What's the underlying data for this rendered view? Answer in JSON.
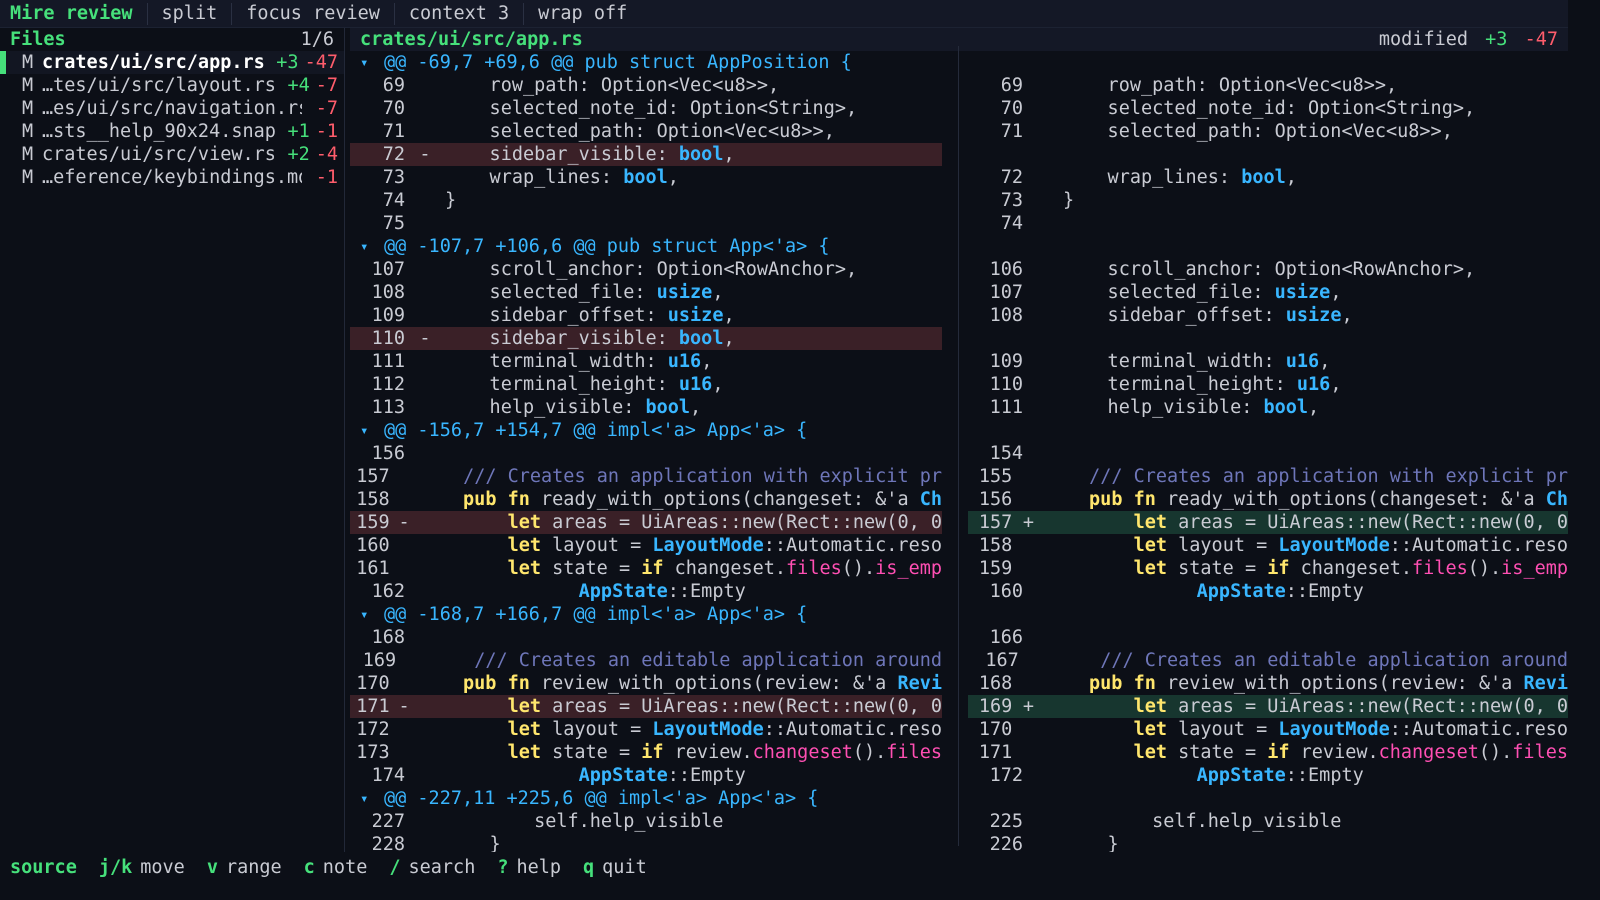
{
  "topbar": {
    "title": "Mire review",
    "tabs": [
      "split",
      "focus review",
      "context 3",
      "wrap off"
    ]
  },
  "sidebar": {
    "header": "Files",
    "count": "1/6",
    "files": [
      {
        "status": "M",
        "name": "crates/ui/src/app.rs",
        "add": "+3",
        "del": "-47",
        "selected": true
      },
      {
        "status": "M",
        "name": "…tes/ui/src/layout.rs",
        "add": "+4",
        "del": "-7"
      },
      {
        "status": "M",
        "name": "…es/ui/src/navigation.rs",
        "add": "",
        "del": "-7"
      },
      {
        "status": "M",
        "name": "…sts__help_90x24.snap",
        "add": "+1",
        "del": "-1"
      },
      {
        "status": "M",
        "name": "crates/ui/src/view.rs",
        "add": "+2",
        "del": "-4"
      },
      {
        "status": "M",
        "name": "…eference/keybindings.md",
        "add": "",
        "del": "-1"
      }
    ]
  },
  "diff": {
    "path": "crates/ui/src/app.rs",
    "status": "modified",
    "add": "+3",
    "del": "-47",
    "hunks": [
      {
        "header": "@@ -69,7 +69,6 @@ pub struct AppPosition {",
        "rows": [
          {
            "l": {
              "n": "69",
              "code": "    row_path: Option<Vec<u8>>,"
            },
            "r": {
              "n": "69",
              "code": "    row_path: Option<Vec<u8>>,"
            }
          },
          {
            "l": {
              "n": "70",
              "code": "    selected_note_id: Option<String>,"
            },
            "r": {
              "n": "70",
              "code": "    selected_note_id: Option<String>,"
            }
          },
          {
            "l": {
              "n": "71",
              "code": "    selected_path: Option<Vec<u8>>,"
            },
            "r": {
              "n": "71",
              "code": "    selected_path: Option<Vec<u8>>,"
            }
          },
          {
            "l": {
              "n": "72",
              "m": "-",
              "kind": "del",
              "code": "    sidebar_visible: bool,"
            },
            "r": {
              "n": "",
              "code": ""
            }
          },
          {
            "l": {
              "n": "73",
              "code": "    wrap_lines: bool,"
            },
            "r": {
              "n": "72",
              "code": "    wrap_lines: bool,"
            }
          },
          {
            "l": {
              "n": "74",
              "code": "}"
            },
            "r": {
              "n": "73",
              "code": "}"
            }
          },
          {
            "l": {
              "n": "75",
              "code": ""
            },
            "r": {
              "n": "74",
              "code": ""
            }
          }
        ]
      },
      {
        "header": "@@ -107,7 +106,6 @@ pub struct App<'a> {",
        "rows": [
          {
            "l": {
              "n": "107",
              "code": "    scroll_anchor: Option<RowAnchor>,"
            },
            "r": {
              "n": "106",
              "code": "    scroll_anchor: Option<RowAnchor>,"
            }
          },
          {
            "l": {
              "n": "108",
              "code": "    selected_file: usize,"
            },
            "r": {
              "n": "107",
              "code": "    selected_file: usize,"
            }
          },
          {
            "l": {
              "n": "109",
              "code": "    sidebar_offset: usize,"
            },
            "r": {
              "n": "108",
              "code": "    sidebar_offset: usize,"
            }
          },
          {
            "l": {
              "n": "110",
              "m": "-",
              "kind": "del",
              "code": "    sidebar_visible: bool,"
            },
            "r": {
              "n": "",
              "code": ""
            }
          },
          {
            "l": {
              "n": "111",
              "code": "    terminal_width: u16,"
            },
            "r": {
              "n": "109",
              "code": "    terminal_width: u16,"
            }
          },
          {
            "l": {
              "n": "112",
              "code": "    terminal_height: u16,"
            },
            "r": {
              "n": "110",
              "code": "    terminal_height: u16,"
            }
          },
          {
            "l": {
              "n": "113",
              "code": "    help_visible: bool,"
            },
            "r": {
              "n": "111",
              "code": "    help_visible: bool,"
            }
          }
        ]
      },
      {
        "header": "@@ -156,7 +154,7 @@ impl<'a> App<'a> {",
        "rows": [
          {
            "l": {
              "n": "156",
              "code": ""
            },
            "r": {
              "n": "154",
              "code": ""
            }
          },
          {
            "l": {
              "n": "157",
              "code": "    /// Creates an application with explicit pr"
            },
            "r": {
              "n": "155",
              "code": "    /// Creates an application with explicit pr"
            }
          },
          {
            "l": {
              "n": "158",
              "code": "    pub fn ready_with_options(changeset: &'a Ch"
            },
            "r": {
              "n": "156",
              "code": "    pub fn ready_with_options(changeset: &'a Ch"
            }
          },
          {
            "l": {
              "n": "159",
              "m": "-",
              "kind": "del",
              "code": "        let areas = UiAreas::new(Rect::new(0, 0"
            },
            "r": {
              "n": "157",
              "m": "+",
              "kind": "add",
              "code": "        let areas = UiAreas::new(Rect::new(0, 0"
            }
          },
          {
            "l": {
              "n": "160",
              "code": "        let layout = LayoutMode::Automatic.reso"
            },
            "r": {
              "n": "158",
              "code": "        let layout = LayoutMode::Automatic.reso"
            }
          },
          {
            "l": {
              "n": "161",
              "code": "        let state = if changeset.files().is_emp"
            },
            "r": {
              "n": "159",
              "code": "        let state = if changeset.files().is_emp"
            }
          },
          {
            "l": {
              "n": "162",
              "code": "            AppState::Empty"
            },
            "r": {
              "n": "160",
              "code": "            AppState::Empty"
            }
          }
        ]
      },
      {
        "header": "@@ -168,7 +166,7 @@ impl<'a> App<'a> {",
        "rows": [
          {
            "l": {
              "n": "168",
              "code": ""
            },
            "r": {
              "n": "166",
              "code": ""
            }
          },
          {
            "l": {
              "n": "169",
              "code": "    /// Creates an editable application around"
            },
            "r": {
              "n": "167",
              "code": "    /// Creates an editable application around"
            }
          },
          {
            "l": {
              "n": "170",
              "code": "    pub fn review_with_options(review: &'a Revi"
            },
            "r": {
              "n": "168",
              "code": "    pub fn review_with_options(review: &'a Revi"
            }
          },
          {
            "l": {
              "n": "171",
              "m": "-",
              "kind": "del",
              "code": "        let areas = UiAreas::new(Rect::new(0, 0"
            },
            "r": {
              "n": "169",
              "m": "+",
              "kind": "add",
              "code": "        let areas = UiAreas::new(Rect::new(0, 0"
            }
          },
          {
            "l": {
              "n": "172",
              "code": "        let layout = LayoutMode::Automatic.reso"
            },
            "r": {
              "n": "170",
              "code": "        let layout = LayoutMode::Automatic.reso"
            }
          },
          {
            "l": {
              "n": "173",
              "code": "        let state = if review.changeset().files"
            },
            "r": {
              "n": "171",
              "code": "        let state = if review.changeset().files"
            }
          },
          {
            "l": {
              "n": "174",
              "code": "            AppState::Empty"
            },
            "r": {
              "n": "172",
              "code": "            AppState::Empty"
            }
          }
        ]
      },
      {
        "header": "@@ -227,11 +225,6 @@ impl<'a> App<'a> {",
        "rows": [
          {
            "l": {
              "n": "227",
              "code": "        self.help_visible"
            },
            "r": {
              "n": "225",
              "code": "        self.help_visible"
            }
          },
          {
            "l": {
              "n": "228",
              "code": "    }"
            },
            "r": {
              "n": "226",
              "code": "    }"
            }
          }
        ]
      }
    ]
  },
  "statusbar": {
    "mode": "source",
    "keys": [
      {
        "key": "j/k",
        "label": "move"
      },
      {
        "key": "v",
        "label": "range"
      },
      {
        "key": "c",
        "label": "note"
      },
      {
        "key": "/",
        "label": "search"
      },
      {
        "key": "?",
        "label": "help"
      },
      {
        "key": "q",
        "label": "quit"
      }
    ]
  },
  "icons": {
    "hunk_toggle": "chevron-down-icon"
  },
  "colors": {
    "accent": "#46e07b",
    "removed": "#ff5d6c",
    "keyword": "#ffe66d",
    "type": "#39b6ff"
  }
}
